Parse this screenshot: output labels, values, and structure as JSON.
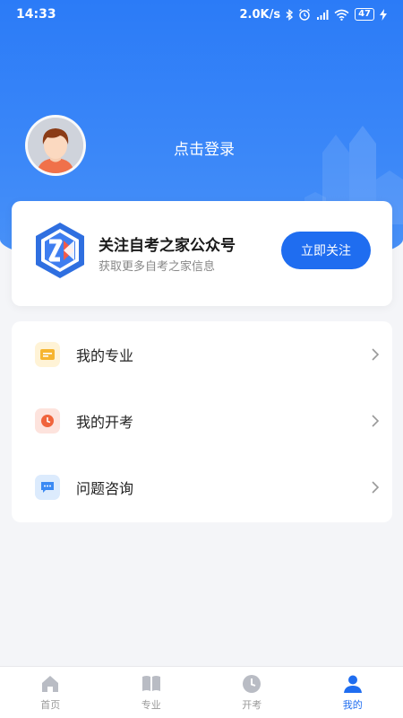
{
  "status_bar": {
    "time": "14:33",
    "net_speed": "2.0K/s",
    "battery": "47",
    "icons": [
      "bluetooth-icon",
      "alarm-icon",
      "signal-icon",
      "wifi-icon",
      "battery-icon",
      "charging-icon"
    ]
  },
  "profile": {
    "login_text": "点击登录"
  },
  "wechat_card": {
    "title": "关注自考之家公众号",
    "subtitle": "获取更多自考之家信息",
    "button_label": "立即关注"
  },
  "menu": {
    "items": [
      {
        "label": "我的专业",
        "icon": "folder-icon",
        "icon_bg": "#fff3d6",
        "icon_color": "#f6b530"
      },
      {
        "label": "我的开考",
        "icon": "clock-icon",
        "icon_bg": "#fde3dd",
        "icon_color": "#f0643c"
      },
      {
        "label": "问题咨询",
        "icon": "chat-icon",
        "icon_bg": "#dcebfd",
        "icon_color": "#3b8af4"
      }
    ]
  },
  "tabbar": {
    "tabs": [
      {
        "label": "首页",
        "icon": "home-icon",
        "active": false
      },
      {
        "label": "专业",
        "icon": "book-icon",
        "active": false
      },
      {
        "label": "开考",
        "icon": "clock-icon",
        "active": false
      },
      {
        "label": "我的",
        "icon": "user-icon",
        "active": true
      }
    ]
  },
  "colors": {
    "primary": "#1f6df0",
    "header_gradient_start": "#2b7bf7",
    "header_gradient_end": "#4a92f7",
    "page_bg": "#f4f5f8"
  }
}
